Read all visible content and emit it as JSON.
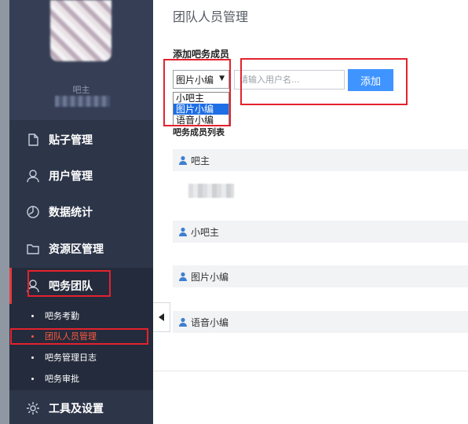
{
  "sidebar": {
    "profile": {
      "name": "吧主"
    },
    "nav": [
      {
        "label": "贴子管理",
        "icon": "document-icon"
      },
      {
        "label": "用户管理",
        "icon": "user-icon"
      },
      {
        "label": "数据统计",
        "icon": "chart-icon"
      },
      {
        "label": "资源区管理",
        "icon": "folder-icon"
      },
      {
        "label": "吧务团队",
        "icon": "team-icon",
        "active": true
      },
      {
        "label": "工具及设置",
        "icon": "gear-icon"
      }
    ],
    "sub_items": [
      {
        "label": "吧务考勤"
      },
      {
        "label": "团队人员管理",
        "active": true
      },
      {
        "label": "吧务管理日志"
      },
      {
        "label": "吧务审批"
      }
    ]
  },
  "main": {
    "page_title": "团队人员管理",
    "add_section_title": "添加吧务成员",
    "role_select": {
      "value": "图片小编",
      "options": [
        "小吧主",
        "图片小编",
        "语音小编"
      ],
      "selected_index": 1
    },
    "username_input": {
      "placeholder": "请输入用户名..."
    },
    "add_button": "添加",
    "list_title": "吧务成员列表",
    "groups": [
      {
        "label": "吧主"
      },
      {
        "label": "小吧主"
      },
      {
        "label": "图片小编"
      },
      {
        "label": "语音小编"
      }
    ]
  },
  "colors": {
    "sidebar_bg": "#2d3549",
    "accent_blue": "#3f94ff",
    "active_red": "#ff5a3c",
    "annotation_red": "#e3222d"
  }
}
